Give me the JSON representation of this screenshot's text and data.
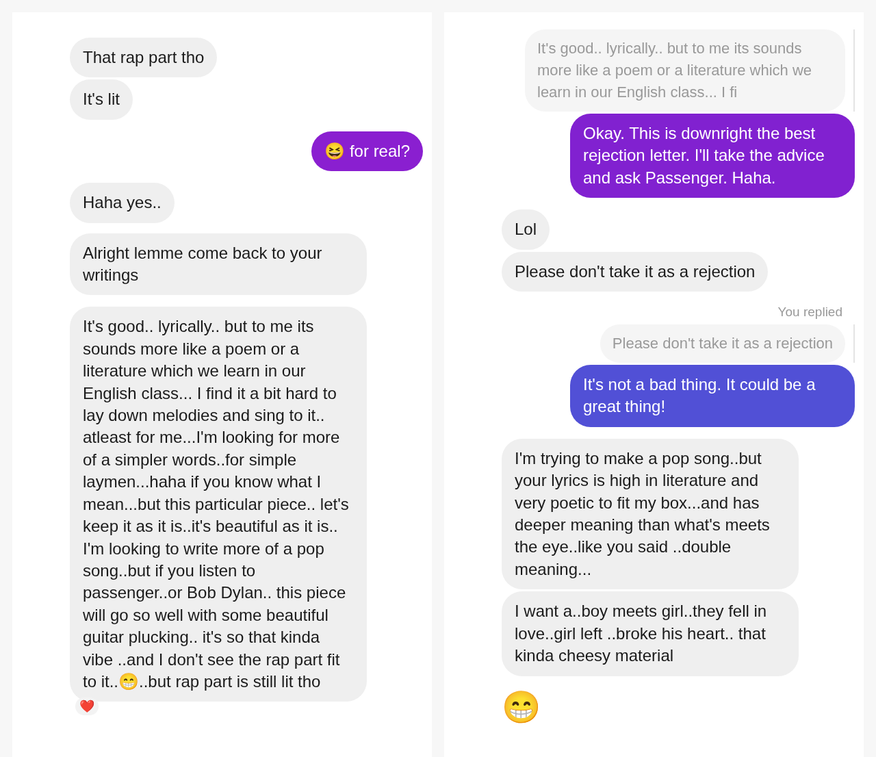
{
  "panels": [
    {
      "messages": [
        {
          "kind": "received",
          "text": "That rap part tho"
        },
        {
          "kind": "received",
          "text": "It's lit"
        },
        {
          "kind": "sent",
          "text": "😆 for real?",
          "color": "#8a1fd0"
        },
        {
          "kind": "received",
          "text": "Haha yes.."
        },
        {
          "kind": "received",
          "text": "Alright lemme come back to your writings"
        },
        {
          "kind": "received",
          "text": "It's good.. lyrically.. but to me its sounds more like a poem or a literature which we learn in our English class... I find it a bit hard to lay down melodies and sing to it.. atleast for me...I'm looking for more of a simpler words..for simple laymen...haha if you know what I mean...but this particular piece.. let's keep it as it is..it's beautiful as it is.. I'm looking to write more of a pop song..but if you listen to passenger..or Bob Dylan.. this piece will go so well with some beautiful guitar plucking.. it's so that kinda vibe ..and I don't see the rap part fit to it..😁..but rap part is still lit tho",
          "reaction": "❤️"
        }
      ]
    },
    {
      "messages": [
        {
          "kind": "quote",
          "text": "It's good.. lyrically.. but to me its sounds more like a poem or a literature which we learn in our English class... I fi"
        },
        {
          "kind": "sent",
          "text": "Okay. This is downright the best rejection letter. I'll take the advice and ask Passenger. Haha.",
          "color": "#8121d0"
        },
        {
          "kind": "received",
          "text": "Lol"
        },
        {
          "kind": "received",
          "text": "Please don't take it as a rejection"
        },
        {
          "kind": "note",
          "text": "You replied"
        },
        {
          "kind": "quote",
          "text": "Please don't take it as a rejection"
        },
        {
          "kind": "sent",
          "text": "It's not a bad thing. It could be a great thing!",
          "color": "#5150d6"
        },
        {
          "kind": "received",
          "text": "I'm trying to make a pop song..but your lyrics is high in literature and very poetic to fit my box...and has deeper meaning than what's meets the eye..like you said ..double meaning..."
        },
        {
          "kind": "received",
          "text": "I want a..boy meets girl..they fell in love..girl left ..broke his heart.. that kinda cheesy material"
        },
        {
          "kind": "emoji",
          "text": "😁"
        }
      ]
    }
  ]
}
